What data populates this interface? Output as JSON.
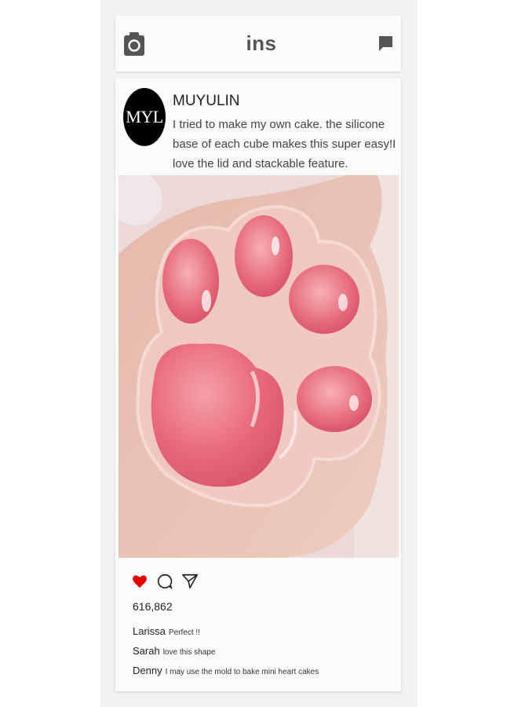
{
  "header": {
    "title": "ins",
    "camera_icon": "camera-icon",
    "message_icon": "message-icon"
  },
  "post": {
    "avatar_text": "MYL",
    "username": "MUYULIN",
    "caption": "I tried to make my own cake. the silicone base of each cube makes this super easy!I love the lid and stackable feature.",
    "image_description": "cat-paw-jelly-photo",
    "likes": "616,862",
    "comments": [
      {
        "user": "Larissa",
        "text": "Perfect !!"
      },
      {
        "user": "Sarah",
        "text": "love this shape"
      },
      {
        "user": "Denny",
        "text": "I may use the mold to bake mini heart cakes"
      }
    ]
  },
  "colors": {
    "heart": "#e00000",
    "avatar_bg": "#000000",
    "paw_pink": "#e86a7a"
  }
}
